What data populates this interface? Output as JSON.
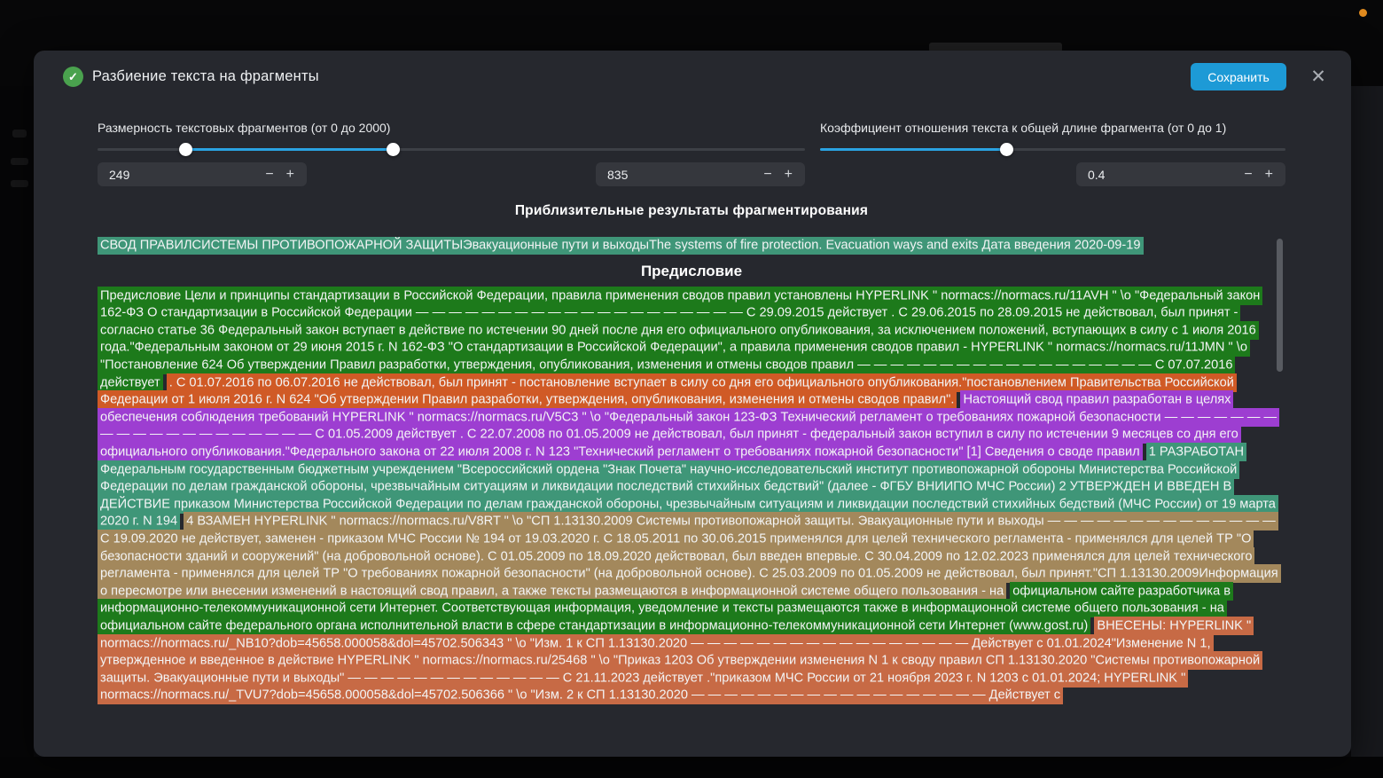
{
  "shell": {
    "notification_dot_color": "#e08a1e"
  },
  "modal": {
    "title": "Разбиение текста на фрагменты",
    "save_label": "Сохранить",
    "close_glyph": "✕",
    "check_glyph": "✓"
  },
  "controls": {
    "size": {
      "label": "Размерность текстовых фрагментов (от 0 до 2000)",
      "min": 0,
      "max": 2000,
      "value_low": "249",
      "value_high": "835"
    },
    "ratio": {
      "label": "Коэффициент отношения текста к общей длине фрагмента (от 0 до 1)",
      "min": 0,
      "max": 1,
      "value": "0.4"
    },
    "stepper": {
      "minus": "−",
      "plus": "+"
    }
  },
  "results": {
    "heading": "Приблизительные результаты фрагментирования",
    "doc_heading": "Предисловие",
    "title_fragment": {
      "color": "#3f9678",
      "text": "СВОД ПРАВИЛСИСТЕМЫ ПРОТИВОПОЖАРНОЙ ЗАЩИТЫЭвакуационные пути и выходыThe systems of fire protection. Evacuation ways and exits Дата введения 2020-09-19"
    },
    "fragments": [
      {
        "color": "#1d7a1b",
        "text": "Предисловие Цели и принципы стандартизации в Российской Федерации, правила применения сводов правил установлены HYPERLINK \" normacs://normacs.ru/11AVH \" \\o \"Федеральный закон 162-ФЗ О стандартизации в Российской Федерации — — — — — — — — — — — — — — — — — — — — С 29.09.2015 действует . С 29.06.2015 по 28.09.2015 не действовал, был принят - согласно статье 36 Федеральный закон вступает в действие по истечении 90 дней после дня его официального опубликования, за исключением положений, вступающих в силу с 1 июля 2016 года.\"Федеральным законом от 29 июня 2015 г. N 162-ФЗ \"О стандартизации в Российской Федерации\", а правила применения сводов правил - HYPERLINK \" normacs://normacs.ru/11JMN \" \\o \"Постановление 624 Об утверждении Правил разработки, утверждения, опубликования, изменения и отмены сводов правил — — — — — — — — — — — — — — — — — — С 07.07.2016 действует"
      },
      {
        "color": "#d05a26",
        "text": ". С 01.07.2016 по 06.07.2016 не действовал, был принят - постановление вступает в силу со дня его официального опубликования.\"постановлением Правительства Российской Федерации от 1 июля 2016 г. N 624 \"Об утверждении Правил разработки, утверждения, опубликования, изменения и отмены сводов правил\"."
      },
      {
        "color": "#9d3ed1",
        "text": "Настоящий свод правил разработан в целях обеспечения соблюдения требований HYPERLINK \" normacs://normacs.ru/V5C3 \" \\o \"Федеральный закон 123-ФЗ Технический регламент о требованиях пожарной безопасности — — — — — — — — — — — — — — — — — — — — С 01.05.2009 действует . С 22.07.2008 по 01.05.2009 не действовал, был принят - федеральный закон вступил в силу по истечении 9 месяцев со дня его официального опубликования.\"Федерального закона от 22 июля 2008 г. N 123 \"Технический регламент о требованиях пожарной безопасности\" [1] Сведения о своде правил"
      },
      {
        "color": "#3f9678",
        "text": "1 РАЗРАБОТАН Федеральным государственным бюджетным учреждением \"Всероссийский ордена \"Знак Почета\" научно-исследовательский институт противопожарной обороны Министерства Российской Федерации по делам гражданской обороны, чрезвычайным ситуациям и ликвидации последствий стихийных бедствий\" (далее - ФГБУ ВНИИПО МЧС России)   2 УТВЕРЖДЕН И ВВЕДЕН В ДЕЙСТВИЕ приказом Министерства Российской Федерации по делам гражданской обороны, чрезвычайным ситуациям и ликвидации последствий стихийных бедствий (МЧС России) от 19 марта 2020 г.  N 194"
      },
      {
        "color": "#a3885c",
        "text": "4 ВЗАМЕН HYPERLINK \" normacs://normacs.ru/V8RT \" \\o \"СП 1.13130.2009 Системы противопожарной защиты. Эвакуационные пути и выходы — — — — — — — — — — — — — — С 19.09.2020 не действует, заменен - приказом МЧС России № 194 от 19.03.2020 г. С 18.05.2011 по 30.06.2015 применялся для целей технического регламента - применялся для целей ТР \"О безопасности зданий и сооружений\" (на добровольной основе). С 01.05.2009 по 18.09.2020 действовал, был введен впервые. С 30.04.2009 по 12.02.2023 применялся для целей технического регламента - применялся для целей ТР \"О требованиях пожарной безопасности\" (на добровольной основе). С 25.03.2009 по 01.05.2009 не действовал, был принят.\"СП 1.13130.2009Информация о пересмотре или внесении изменений в настоящий свод правил, а также тексты размещаются в информационной системе общего пользования - на"
      },
      {
        "color": "#1d7a1b",
        "text": "официальном сайте разработчика в информационно-телекоммуникационной сети Интернет. Соответствующая информация, уведомление и тексты размещаются также в информационной системе общего пользования - на официальном сайте федерального органа исполнительной власти в сфере стандартизации в информационно-телекоммуникационной сети Интернет (www.gost.ru)"
      },
      {
        "color": "#c76a45",
        "text": "ВНЕСЕНЫ: HYPERLINK \" normacs://normacs.ru/_NB10?dob=45658.000058&dol=45702.506343 \" \\o \"Изм. 1 к СП 1.13130.2020 — — — — — — — — — — — — — — — — — Действует с 01.01.2024\"Изменение N 1, утвержденное и введенное в действие HYPERLINK \" normacs://normacs.ru/25468 \" \\o \"Приказ 1203 Об утверждении изменения N 1 к своду правил СП 1.13130.2020 \"Системы противопожарной защиты. Эвакуационные пути и выходы\" — — — — — — — — — — — — — С 21.11.2023 действует .\"приказом МЧС России от 21 ноября 2023 г. N 1203 с 01.01.2024; HYPERLINK \" normacs://normacs.ru/_TVU7?dob=45658.000058&dol=45702.506366 \" \\o \"Изм. 2 к СП 1.13130.2020 — — — — — — — — — — — — — — — — — — Действует с"
      }
    ]
  }
}
